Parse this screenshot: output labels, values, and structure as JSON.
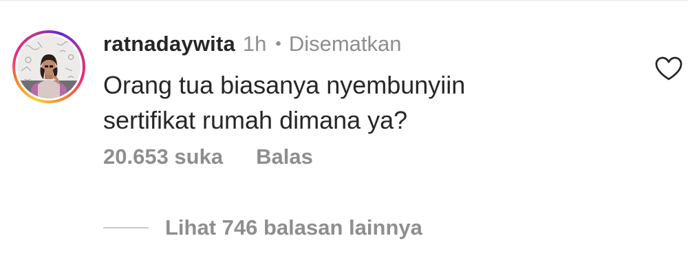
{
  "comment": {
    "avatar_icon": "profile-photo",
    "avatar_ring_colors": [
      "#f9ce34",
      "#ee2a7b",
      "#6228d7"
    ],
    "username": "ratnadaywita",
    "time": "1h",
    "separator": "•",
    "pinned_label": "Disematkan",
    "text_lines": [
      "Orang tua biasanya nyembunyiin",
      "sertifikat rumah dimana ya?"
    ],
    "like_icon": "heart-outline-icon",
    "likes_label": "20.653 suka",
    "reply_label": "Balas"
  },
  "replies": {
    "label": "Lihat 746 balasan lainnya"
  },
  "colors": {
    "text_primary": "#262626",
    "text_secondary": "#8e8e8e",
    "divider": "#c7c7c7"
  }
}
